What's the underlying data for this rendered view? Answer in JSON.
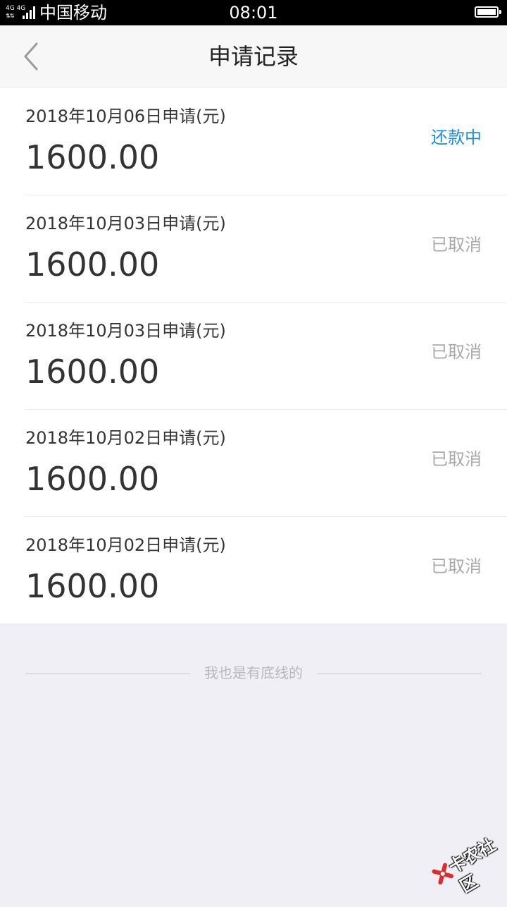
{
  "status_bar": {
    "network": "4G 4G",
    "carrier": "中国移动",
    "time": "08:01",
    "battery_level": 1.0
  },
  "nav": {
    "title": "申请记录",
    "back_icon": "chevron-left-icon"
  },
  "records": [
    {
      "date": "2018年10月06日申请(元)",
      "amount": "1600.00",
      "status": "还款中",
      "status_color": "#1a8fe3"
    },
    {
      "date": "2018年10月03日申请(元)",
      "amount": "1600.00",
      "status": "已取消",
      "status_color": "#a9a9a9"
    },
    {
      "date": "2018年10月03日申请(元)",
      "amount": "1600.00",
      "status": "已取消",
      "status_color": "#a9a9a9"
    },
    {
      "date": "2018年10月02日申请(元)",
      "amount": "1600.00",
      "status": "已取消",
      "status_color": "#a9a9a9"
    },
    {
      "date": "2018年10月02日申请(元)",
      "amount": "1600.00",
      "status": "已取消",
      "status_color": "#a9a9a9"
    }
  ],
  "footer": {
    "text": "我也是有底线的"
  },
  "watermark": {
    "text": "卡农社区",
    "icon": "kanong-logo-icon"
  }
}
